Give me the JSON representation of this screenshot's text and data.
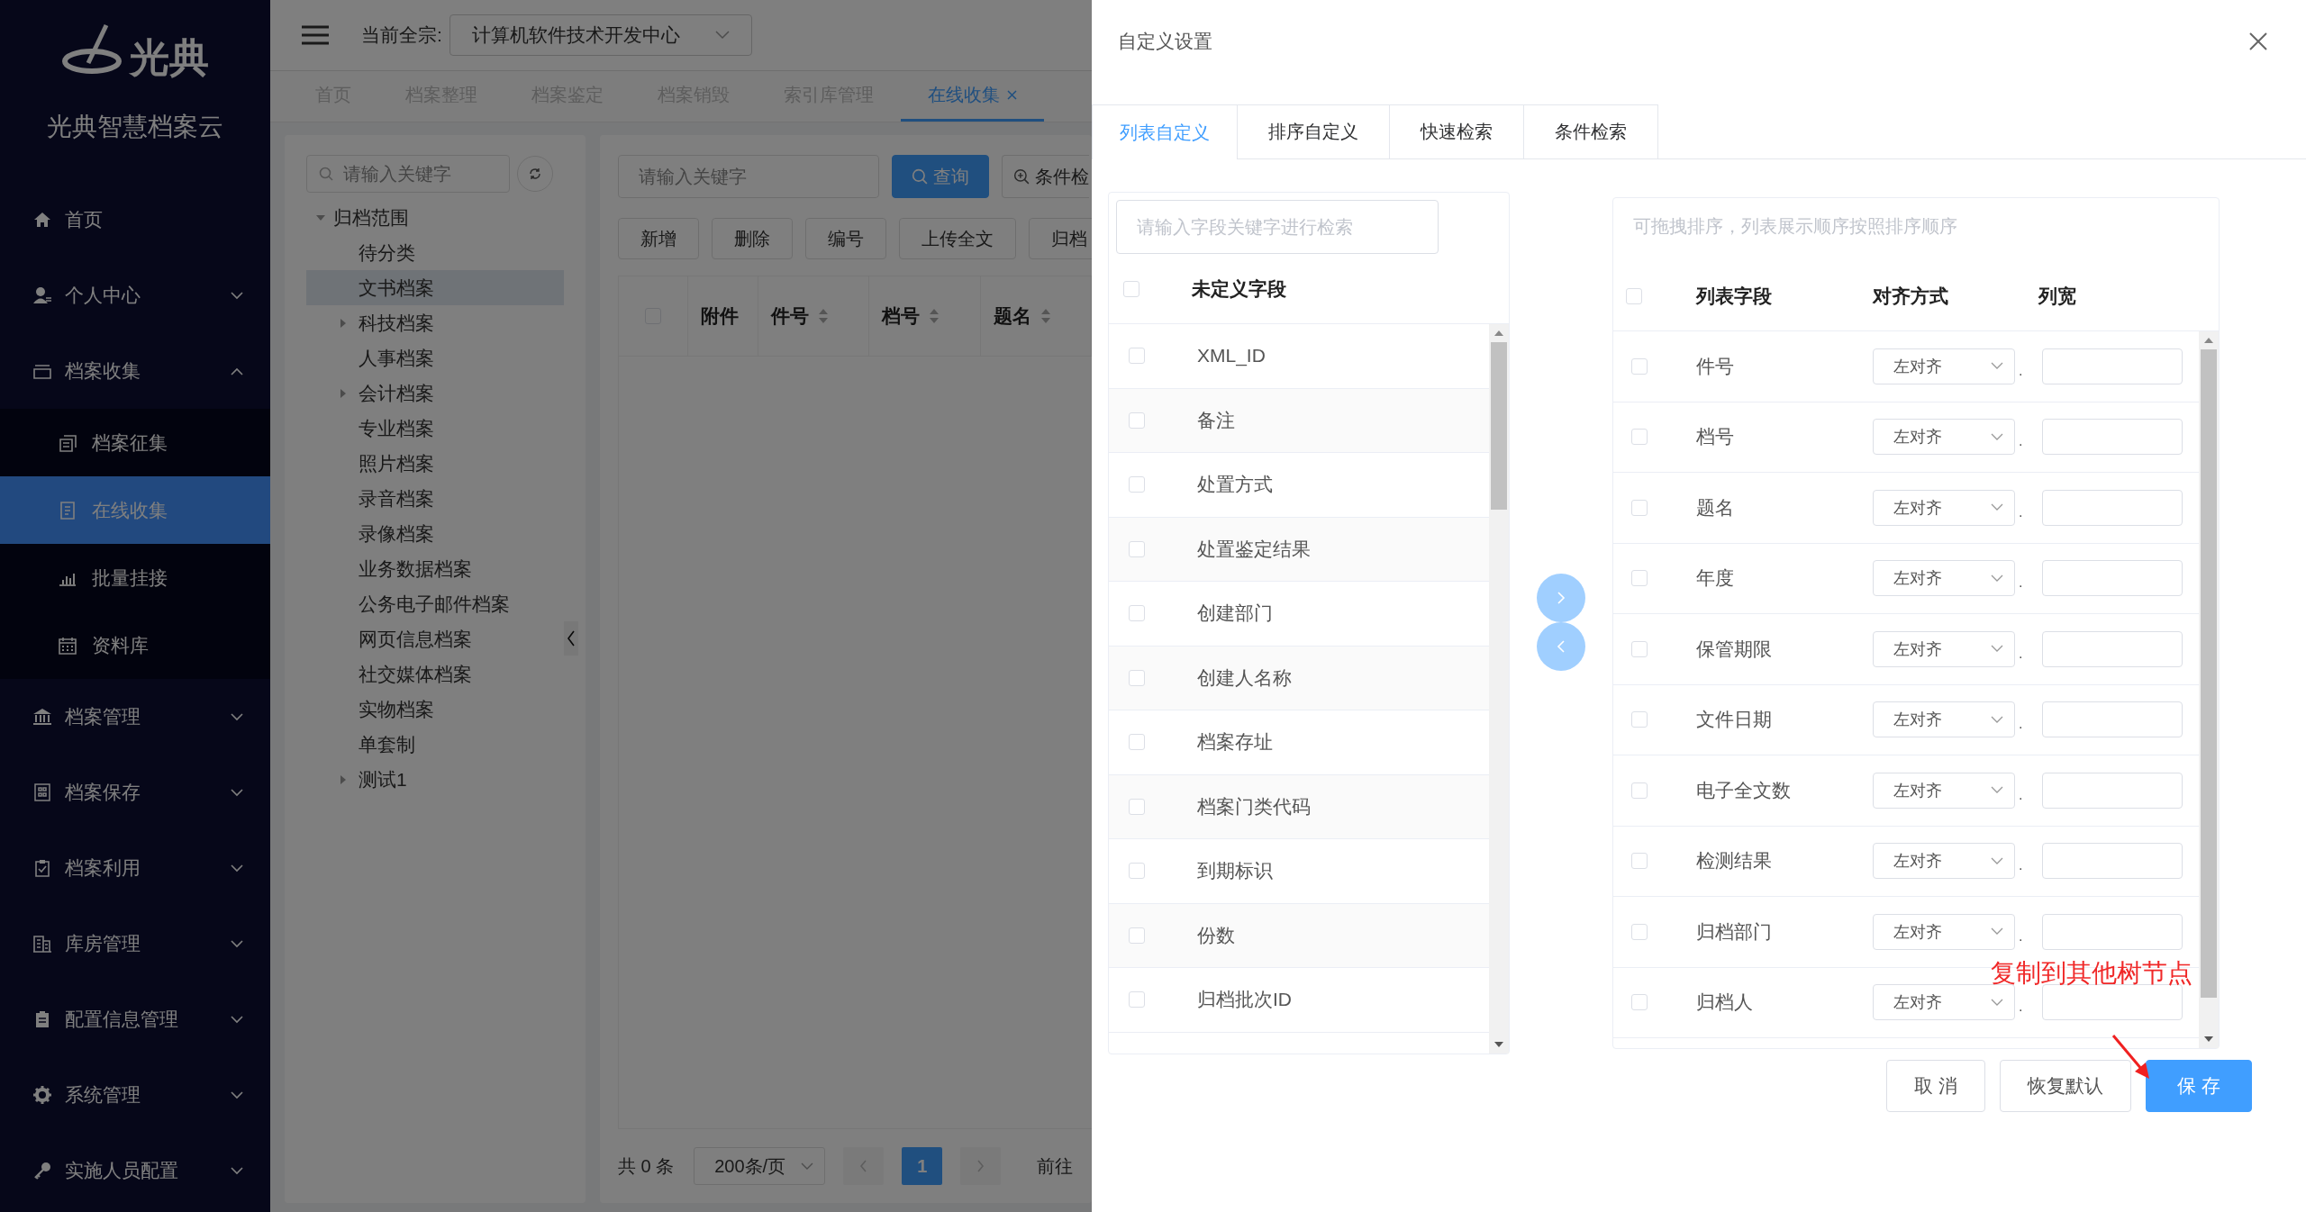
{
  "sidebar": {
    "logo_text": "光典",
    "app_name": "光典智慧档案云",
    "items": [
      {
        "label": "首页"
      },
      {
        "label": "个人中心",
        "expanded": false
      },
      {
        "label": "档案收集",
        "expanded": true,
        "children": [
          {
            "label": "档案征集",
            "selected": false
          },
          {
            "label": "在线收集",
            "selected": true
          },
          {
            "label": "批量挂接",
            "selected": false
          },
          {
            "label": "资料库",
            "selected": false
          }
        ]
      },
      {
        "label": "档案管理",
        "expanded": false
      },
      {
        "label": "档案保存",
        "expanded": false
      },
      {
        "label": "档案利用",
        "expanded": false
      },
      {
        "label": "库房管理",
        "expanded": false
      },
      {
        "label": "配置信息管理",
        "expanded": false
      },
      {
        "label": "系统管理",
        "expanded": false
      },
      {
        "label": "实施人员配置",
        "expanded": false
      }
    ]
  },
  "header": {
    "fonds_label": "当前全宗:",
    "fonds_value": "计算机软件技术开发中心"
  },
  "tabs": [
    {
      "label": "首页",
      "selected": false
    },
    {
      "label": "档案整理",
      "selected": false
    },
    {
      "label": "档案鉴定",
      "selected": false
    },
    {
      "label": "档案销毁",
      "selected": false
    },
    {
      "label": "索引库管理",
      "selected": false
    },
    {
      "label": "在线收集",
      "selected": true
    }
  ],
  "tree": {
    "search_placeholder": "请输入关键字",
    "root": {
      "label": "归档范围",
      "expanded": true,
      "children": [
        {
          "label": "待分类",
          "selected": false,
          "collapsed": false
        },
        {
          "label": "文书档案",
          "selected": true,
          "collapsed": false
        },
        {
          "label": "科技档案",
          "selected": false,
          "collapsed": true
        },
        {
          "label": "人事档案",
          "selected": false,
          "collapsed": false
        },
        {
          "label": "会计档案",
          "selected": false,
          "collapsed": true
        },
        {
          "label": "专业档案",
          "selected": false,
          "collapsed": false
        },
        {
          "label": "照片档案",
          "selected": false,
          "collapsed": false
        },
        {
          "label": "录音档案",
          "selected": false,
          "collapsed": false
        },
        {
          "label": "录像档案",
          "selected": false,
          "collapsed": false
        },
        {
          "label": "业务数据档案",
          "selected": false,
          "collapsed": false
        },
        {
          "label": "公务电子邮件档案",
          "selected": false,
          "collapsed": false
        },
        {
          "label": "网页信息档案",
          "selected": false,
          "collapsed": false
        },
        {
          "label": "社交媒体档案",
          "selected": false,
          "collapsed": false
        },
        {
          "label": "实物档案",
          "selected": false,
          "collapsed": false
        },
        {
          "label": "单套制",
          "selected": false,
          "collapsed": false
        },
        {
          "label": "测试1",
          "selected": false,
          "collapsed": true
        }
      ]
    }
  },
  "main": {
    "search_placeholder": "请输入关键字",
    "query_button": "查询",
    "filter_button": "条件检",
    "actions": [
      "新增",
      "删除",
      "编号",
      "上传全文",
      "归档"
    ],
    "table": {
      "select_all": false,
      "columns": [
        {
          "label": "附件",
          "sortable": false
        },
        {
          "label": "件号",
          "sortable": true
        },
        {
          "label": "档号",
          "sortable": true
        },
        {
          "label": "题名",
          "sortable": true
        }
      ]
    },
    "pagination": {
      "total": "共 0 条",
      "page_size": "200条/页",
      "pages": [
        {
          "label": "1",
          "selected": true
        }
      ],
      "goto_label": "前往"
    }
  },
  "dialog": {
    "title": "自定义设置",
    "tabs": [
      {
        "label": "列表自定义",
        "selected": true
      },
      {
        "label": "排序自定义",
        "selected": false
      },
      {
        "label": "快速检索",
        "selected": false
      },
      {
        "label": "条件检索",
        "selected": false
      }
    ],
    "available": {
      "search_placeholder": "请输入字段关键字进行检索",
      "header": "未定义字段",
      "select_all": false,
      "rows": [
        {
          "label": "XML_ID",
          "checked": false
        },
        {
          "label": "备注",
          "checked": false
        },
        {
          "label": "处置方式",
          "checked": false
        },
        {
          "label": "处置鉴定结果",
          "checked": false
        },
        {
          "label": "创建部门",
          "checked": false
        },
        {
          "label": "创建人名称",
          "checked": false
        },
        {
          "label": "档案存址",
          "checked": false
        },
        {
          "label": "档案门类代码",
          "checked": false
        },
        {
          "label": "到期标识",
          "checked": false
        },
        {
          "label": "份数",
          "checked": false
        },
        {
          "label": "归档批次ID",
          "checked": false
        }
      ]
    },
    "selected_fields": {
      "hint": "可拖拽排序，列表展示顺序按照排序顺序",
      "select_all": false,
      "columns": [
        "列表字段",
        "对齐方式",
        "列宽"
      ],
      "rows": [
        {
          "label": "件号",
          "checked": false,
          "align": "左对齐",
          "separator": "."
        },
        {
          "label": "档号",
          "checked": false,
          "align": "左对齐",
          "separator": "."
        },
        {
          "label": "题名",
          "checked": false,
          "align": "左对齐",
          "separator": "."
        },
        {
          "label": "年度",
          "checked": false,
          "align": "左对齐",
          "separator": "."
        },
        {
          "label": "保管期限",
          "checked": false,
          "align": "左对齐",
          "separator": "."
        },
        {
          "label": "文件日期",
          "checked": false,
          "align": "左对齐",
          "separator": "."
        },
        {
          "label": "电子全文数",
          "checked": false,
          "align": "左对齐",
          "separator": "."
        },
        {
          "label": "检测结果",
          "checked": false,
          "align": "左对齐",
          "separator": "."
        },
        {
          "label": "归档部门",
          "checked": false,
          "align": "左对齐",
          "separator": "."
        },
        {
          "label": "归档人",
          "checked": false,
          "align": "左对齐",
          "separator": "."
        }
      ]
    },
    "buttons": [
      {
        "label": "取 消",
        "kind": "default"
      },
      {
        "label": "恢复默认",
        "kind": "default"
      },
      {
        "label": "保 存",
        "kind": "primary"
      }
    ],
    "annotation": "复制到其他树节点"
  }
}
